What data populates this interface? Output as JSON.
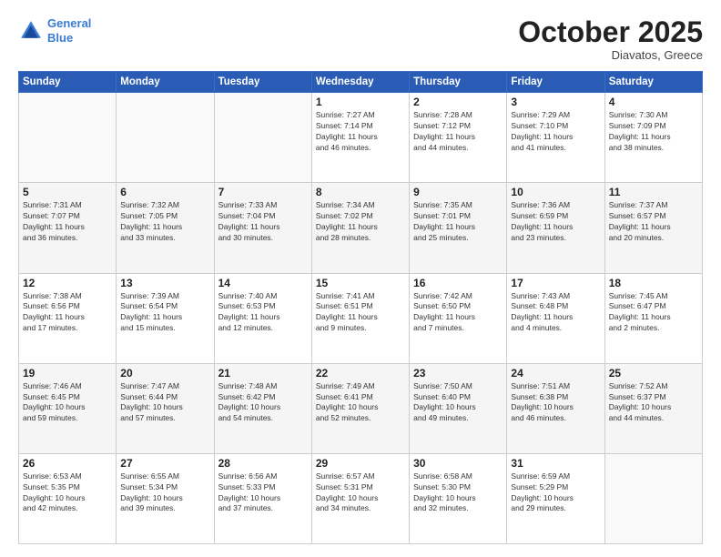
{
  "header": {
    "logo_line1": "General",
    "logo_line2": "Blue",
    "month": "October 2025",
    "location": "Diavatos, Greece"
  },
  "days_of_week": [
    "Sunday",
    "Monday",
    "Tuesday",
    "Wednesday",
    "Thursday",
    "Friday",
    "Saturday"
  ],
  "weeks": [
    [
      {
        "num": "",
        "info": ""
      },
      {
        "num": "",
        "info": ""
      },
      {
        "num": "",
        "info": ""
      },
      {
        "num": "1",
        "info": "Sunrise: 7:27 AM\nSunset: 7:14 PM\nDaylight: 11 hours\nand 46 minutes."
      },
      {
        "num": "2",
        "info": "Sunrise: 7:28 AM\nSunset: 7:12 PM\nDaylight: 11 hours\nand 44 minutes."
      },
      {
        "num": "3",
        "info": "Sunrise: 7:29 AM\nSunset: 7:10 PM\nDaylight: 11 hours\nand 41 minutes."
      },
      {
        "num": "4",
        "info": "Sunrise: 7:30 AM\nSunset: 7:09 PM\nDaylight: 11 hours\nand 38 minutes."
      }
    ],
    [
      {
        "num": "5",
        "info": "Sunrise: 7:31 AM\nSunset: 7:07 PM\nDaylight: 11 hours\nand 36 minutes."
      },
      {
        "num": "6",
        "info": "Sunrise: 7:32 AM\nSunset: 7:05 PM\nDaylight: 11 hours\nand 33 minutes."
      },
      {
        "num": "7",
        "info": "Sunrise: 7:33 AM\nSunset: 7:04 PM\nDaylight: 11 hours\nand 30 minutes."
      },
      {
        "num": "8",
        "info": "Sunrise: 7:34 AM\nSunset: 7:02 PM\nDaylight: 11 hours\nand 28 minutes."
      },
      {
        "num": "9",
        "info": "Sunrise: 7:35 AM\nSunset: 7:01 PM\nDaylight: 11 hours\nand 25 minutes."
      },
      {
        "num": "10",
        "info": "Sunrise: 7:36 AM\nSunset: 6:59 PM\nDaylight: 11 hours\nand 23 minutes."
      },
      {
        "num": "11",
        "info": "Sunrise: 7:37 AM\nSunset: 6:57 PM\nDaylight: 11 hours\nand 20 minutes."
      }
    ],
    [
      {
        "num": "12",
        "info": "Sunrise: 7:38 AM\nSunset: 6:56 PM\nDaylight: 11 hours\nand 17 minutes."
      },
      {
        "num": "13",
        "info": "Sunrise: 7:39 AM\nSunset: 6:54 PM\nDaylight: 11 hours\nand 15 minutes."
      },
      {
        "num": "14",
        "info": "Sunrise: 7:40 AM\nSunset: 6:53 PM\nDaylight: 11 hours\nand 12 minutes."
      },
      {
        "num": "15",
        "info": "Sunrise: 7:41 AM\nSunset: 6:51 PM\nDaylight: 11 hours\nand 9 minutes."
      },
      {
        "num": "16",
        "info": "Sunrise: 7:42 AM\nSunset: 6:50 PM\nDaylight: 11 hours\nand 7 minutes."
      },
      {
        "num": "17",
        "info": "Sunrise: 7:43 AM\nSunset: 6:48 PM\nDaylight: 11 hours\nand 4 minutes."
      },
      {
        "num": "18",
        "info": "Sunrise: 7:45 AM\nSunset: 6:47 PM\nDaylight: 11 hours\nand 2 minutes."
      }
    ],
    [
      {
        "num": "19",
        "info": "Sunrise: 7:46 AM\nSunset: 6:45 PM\nDaylight: 10 hours\nand 59 minutes."
      },
      {
        "num": "20",
        "info": "Sunrise: 7:47 AM\nSunset: 6:44 PM\nDaylight: 10 hours\nand 57 minutes."
      },
      {
        "num": "21",
        "info": "Sunrise: 7:48 AM\nSunset: 6:42 PM\nDaylight: 10 hours\nand 54 minutes."
      },
      {
        "num": "22",
        "info": "Sunrise: 7:49 AM\nSunset: 6:41 PM\nDaylight: 10 hours\nand 52 minutes."
      },
      {
        "num": "23",
        "info": "Sunrise: 7:50 AM\nSunset: 6:40 PM\nDaylight: 10 hours\nand 49 minutes."
      },
      {
        "num": "24",
        "info": "Sunrise: 7:51 AM\nSunset: 6:38 PM\nDaylight: 10 hours\nand 46 minutes."
      },
      {
        "num": "25",
        "info": "Sunrise: 7:52 AM\nSunset: 6:37 PM\nDaylight: 10 hours\nand 44 minutes."
      }
    ],
    [
      {
        "num": "26",
        "info": "Sunrise: 6:53 AM\nSunset: 5:35 PM\nDaylight: 10 hours\nand 42 minutes."
      },
      {
        "num": "27",
        "info": "Sunrise: 6:55 AM\nSunset: 5:34 PM\nDaylight: 10 hours\nand 39 minutes."
      },
      {
        "num": "28",
        "info": "Sunrise: 6:56 AM\nSunset: 5:33 PM\nDaylight: 10 hours\nand 37 minutes."
      },
      {
        "num": "29",
        "info": "Sunrise: 6:57 AM\nSunset: 5:31 PM\nDaylight: 10 hours\nand 34 minutes."
      },
      {
        "num": "30",
        "info": "Sunrise: 6:58 AM\nSunset: 5:30 PM\nDaylight: 10 hours\nand 32 minutes."
      },
      {
        "num": "31",
        "info": "Sunrise: 6:59 AM\nSunset: 5:29 PM\nDaylight: 10 hours\nand 29 minutes."
      },
      {
        "num": "",
        "info": ""
      }
    ]
  ]
}
